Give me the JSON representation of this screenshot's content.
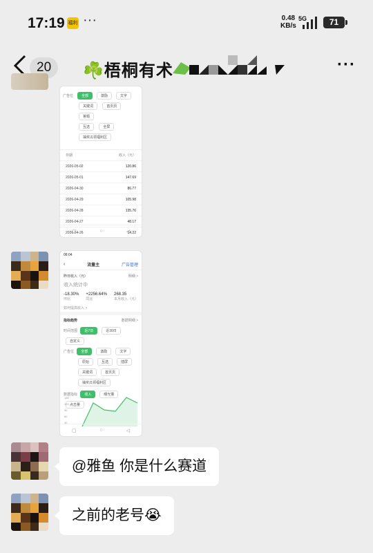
{
  "status_bar": {
    "time": "17:19",
    "app_badge": "福利",
    "more": "···",
    "net_speed": "0.48\nKB/s",
    "network": "5G",
    "battery": "71"
  },
  "nav": {
    "unread_count": "20",
    "title": "梧桐有术",
    "title_icon": "☘️"
  },
  "thumb1": {
    "label_type": "广告位",
    "chips_row1": [
      "全部",
      "激励",
      "文字"
    ],
    "chips_row2": [
      "关键词",
      "首页页",
      "答题"
    ],
    "chips_row3": [
      "互选",
      "全屏"
    ],
    "chip_row4": "抽奖瓜领福利区",
    "col_date": "日期",
    "col_income": "收入（元）",
    "rows": [
      {
        "date": "2026-05-02",
        "value": "120.86"
      },
      {
        "date": "2026-05-01",
        "value": "147.69"
      },
      {
        "date": "2026-04-30",
        "value": "86.77"
      },
      {
        "date": "2026-04-29",
        "value": "105.98"
      },
      {
        "date": "2026-04-28",
        "value": "135.76"
      },
      {
        "date": "2026-04-27",
        "value": "48.17"
      },
      {
        "date": "2026-04-26",
        "value": "14.22"
      }
    ]
  },
  "thumb2": {
    "time": "08:04",
    "header_title": "流量主",
    "header_right": "广告管理",
    "yesterday_label": "昨日收入（元）",
    "yesterday_link": "明细 >",
    "yesterday_value": "收入统计中",
    "stat1": "-18.30%",
    "stat1_label": "环比",
    "stat2": "+2256.64%",
    "stat2_label": "同比",
    "stat3": "268.35",
    "stat3_label": "本月收入（元）",
    "notice": "如何提高收入 >",
    "trend_title": "指标趋势",
    "trend_link": "数据明细 >",
    "range_label": "时间范围",
    "ranges": [
      "近7日",
      "近30日",
      "自定义"
    ],
    "ad_label": "广告位",
    "ad_chips": [
      "全部",
      "激励",
      "文字",
      "原始",
      "互选",
      "插屏",
      "关键词",
      "首页页",
      "抽奖瓜领福利区"
    ],
    "data_label": "数据指标",
    "data_chips": [
      "收入",
      "曝光量",
      "点击量"
    ],
    "y_ticks": [
      "150",
      "120",
      "90",
      "60",
      "30"
    ]
  },
  "messages": [
    {
      "text": "@雅鱼  你是什么赛道"
    },
    {
      "text": "之前的老号",
      "emoji": "😭"
    }
  ],
  "colors": {
    "accent": "#3fbf6a",
    "background": "#ededed",
    "bubble": "#ffffff"
  },
  "icons": [
    "back-icon",
    "more-icon",
    "signal-icon",
    "battery-icon",
    "clover-icon"
  ]
}
